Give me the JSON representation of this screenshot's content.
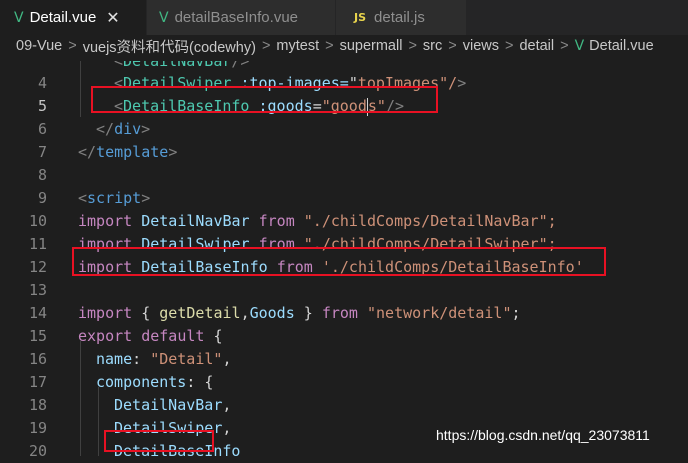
{
  "tabs": [
    {
      "label": "Detail.vue",
      "icon": "vue-icon",
      "active": true,
      "close": "✕"
    },
    {
      "label": "detailBaseInfo.vue",
      "icon": "vue-icon",
      "active": false
    },
    {
      "label": "detail.js",
      "icon": "js-icon",
      "active": false
    }
  ],
  "icons": {
    "vue": "V",
    "js": "JS"
  },
  "breadcrumb": [
    "09-Vue",
    "vuejs资料和代码(codewhy)",
    "mytest",
    "supermall",
    "src",
    "views",
    "detail",
    "Detail.vue"
  ],
  "breadcrumb_separator": ">",
  "editor": {
    "lines": [
      {
        "n": "",
        "text": "<DetailNavBar/>"
      },
      {
        "n": "4",
        "text": "<DetailSwiper :top-images=\"topImages\"/>"
      },
      {
        "n": "5",
        "text": "<DetailBaseInfo :goods=\"goods\"/>"
      },
      {
        "n": "6",
        "text": "</div>"
      },
      {
        "n": "7",
        "text": "</template>"
      },
      {
        "n": "8",
        "text": ""
      },
      {
        "n": "9",
        "text": "<script>"
      },
      {
        "n": "10",
        "text": "import DetailNavBar from \"./childComps/DetailNavBar\";"
      },
      {
        "n": "11",
        "text": "import DetailSwiper from \"./childComps/DetailSwiper\";"
      },
      {
        "n": "12",
        "text": "import DetailBaseInfo from './childComps/DetailBaseInfo'"
      },
      {
        "n": "13",
        "text": ""
      },
      {
        "n": "14",
        "text": "import { getDetail,Goods } from \"network/detail\";"
      },
      {
        "n": "15",
        "text": "export default {"
      },
      {
        "n": "16",
        "text": "name: \"Detail\","
      },
      {
        "n": "17",
        "text": "components: {"
      },
      {
        "n": "18",
        "text": "DetailNavBar,"
      },
      {
        "n": "19",
        "text": "DetailSwiper,"
      },
      {
        "n": "20",
        "text": "DetailBaseInfo"
      }
    ]
  },
  "watermark": "https://blog.csdn.net/qq_23073811",
  "colors": {
    "annotation_box": "#e81123",
    "background": "#1e1e1e",
    "vue_icon": "#41b883",
    "js_icon": "#e8d44d"
  }
}
